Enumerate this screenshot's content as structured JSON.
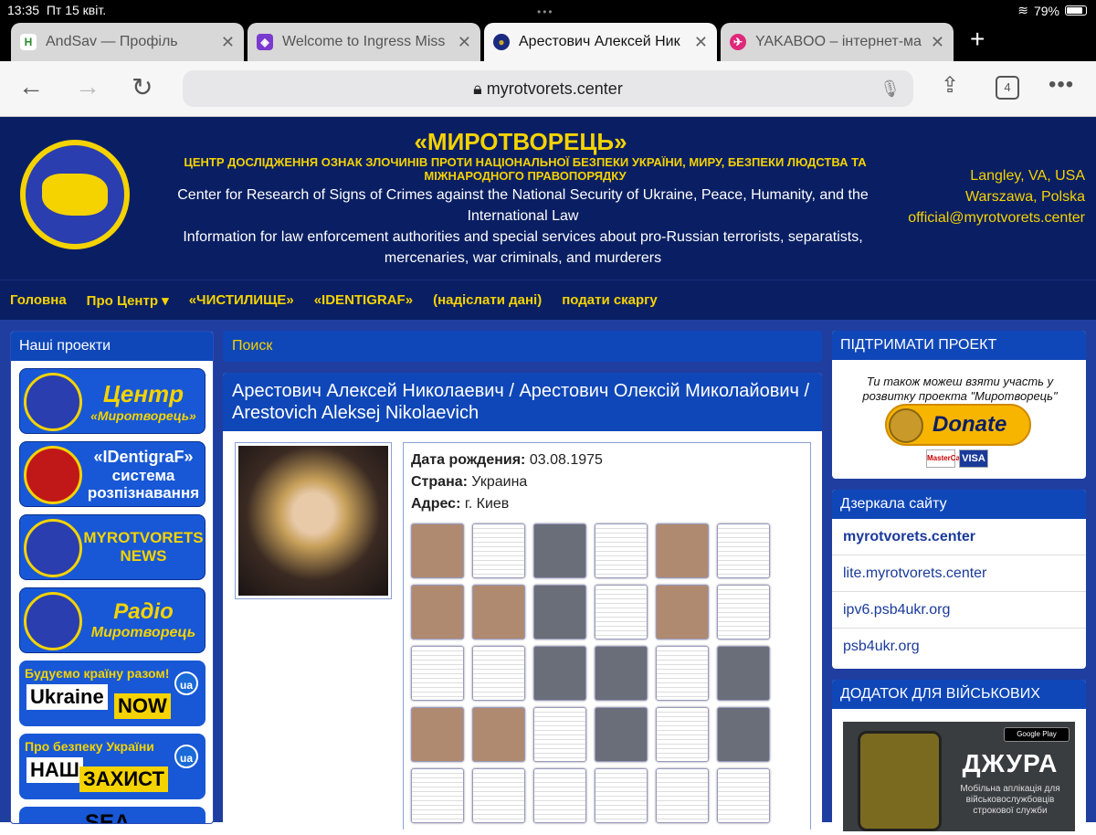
{
  "status": {
    "time": "13:35",
    "date": "Пт 15 квіт.",
    "battery": "79%"
  },
  "tabs": [
    {
      "title": "AndSav — Профіль",
      "icon": "H",
      "icon_color": "#2a8a2a"
    },
    {
      "title": "Welcome to Ingress Miss",
      "icon": "◈",
      "icon_color": "#7a3ad0"
    },
    {
      "title": "Арестович Алексей Ник",
      "icon": "●",
      "icon_color": "#c9a92a",
      "active": true
    },
    {
      "title": "YAKABOO – інтернет-ма",
      "icon": "✈",
      "icon_color": "#e0287a"
    }
  ],
  "toolbar": {
    "url": "myrotvorets.center",
    "tab_count": "4"
  },
  "header": {
    "title": "«МИРОТВОРЕЦЬ»",
    "subtitle": "ЦЕНТР ДОСЛІДЖЕННЯ ОЗНАК ЗЛОЧИНІВ ПРОТИ НАЦІОНАЛЬНОЇ БЕЗПЕКИ УКРАЇНИ, МИРУ, БЕЗПЕКИ ЛЮДСТВА ТА МІЖНАРОДНОГО ПРАВОПОРЯДКУ",
    "english": "Center for Research of Signs of Crimes against the National Security of Ukraine, Peace, Humanity, and the International Law",
    "info": "Information for law enforcement authorities and special services about pro-Russian terrorists, separatists, mercenaries, war criminals, and murderers",
    "loc1": "Langley, VA, USA",
    "loc2": "Warszawa, Polska",
    "email": "official@myrotvorets.center"
  },
  "menu": [
    "Головна",
    "Про Центр ▾",
    "«ЧИСТИЛИЩЕ»",
    "«IDENTIGRAF»",
    "(надіслати дані)",
    "подати скаргу"
  ],
  "left": {
    "title": "Наші проекти",
    "p1": "Центр «Миротворець»",
    "p1a": "Центр",
    "p1b": "«Миротворець»",
    "p2a": "«IDentigraF»",
    "p2b": "система розпізнавання",
    "p3a": "MYROTVORETS",
    "p3b": "NEWS",
    "p4a": "Радіо",
    "p4b": "Миротворець",
    "ua1_t": "Будуємо країну разом!",
    "ua1_w": "Ukraine",
    "ua1_y": "NOW",
    "ua2_t": "Про безпеку України",
    "ua2_w": "НАШ",
    "ua2_y": "ЗАХИСТ",
    "ua_badge": "ua",
    "p5": "SEA"
  },
  "main": {
    "search": "Поиск",
    "name": "Арестович Алексей Николаевич / Арестович Олексій Миколайович / Arestovich Aleksej Nikolaevich",
    "dob_label": "Дата рождения:",
    "dob": "03.08.1975",
    "country_label": "Страна:",
    "country": "Украина",
    "addr_label": "Адрес:",
    "addr": "г. Киев"
  },
  "right": {
    "support": "ПІДТРИМАТИ ПРОЕКТ",
    "donate_text": "Ти також можеш взяти участь у розвитку проекта \"Миротворець\"",
    "donate": "Donate",
    "mc": "MasterCard",
    "visa": "VISA",
    "mirrors_title": "Дзеркала сайту",
    "mirrors": [
      "myrotvorets.center",
      "lite.myrotvorets.center",
      "ipv6.psb4ukr.org",
      "psb4ukr.org"
    ],
    "app_title": "ДОДАТОК ДЛЯ ВІЙСЬКОВИХ",
    "app_name": "ДЖУРА",
    "app_desc": "Мобільна аплікація для військовослужбовців строкової служби",
    "gp": "Google Play"
  },
  "colors": {
    "navy": "#0a1f63",
    "yellow": "#f5d300",
    "blue": "#1f3ea0"
  }
}
